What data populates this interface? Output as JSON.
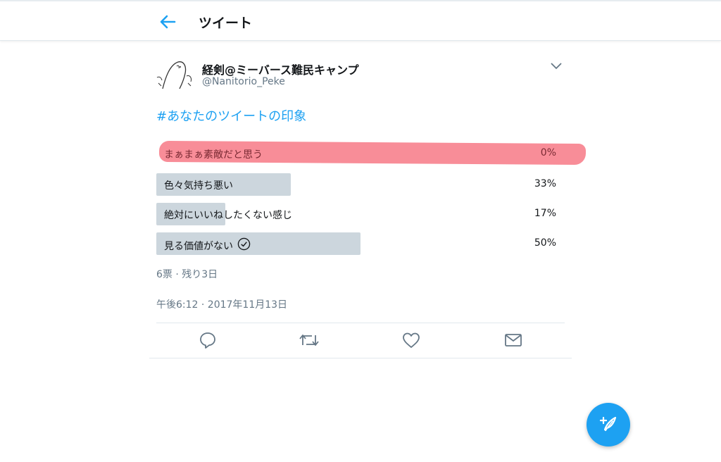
{
  "header": {
    "title": "ツイート"
  },
  "tweet": {
    "author_name": "経剣@ミーバース難民キャンプ",
    "handle": "@Nanitorio_Peke",
    "hashtag": "#あなたのツイートの印象",
    "poll": {
      "options": [
        {
          "label": "まぁまぁ素敵だと思う",
          "percent": "0%",
          "value": 0,
          "highlighted": true
        },
        {
          "label": "色々気持ち悪い",
          "percent": "33%",
          "value": 33
        },
        {
          "label": "絶対にいいねしたくない感じ",
          "percent": "17%",
          "value": 17
        },
        {
          "label": "見る価値がない",
          "percent": "50%",
          "value": 50,
          "voted": true
        }
      ],
      "meta": "6票 · 残り3日"
    },
    "timestamp": "午後6:12 · 2017年11月13日"
  },
  "colors": {
    "accent": "#1da1f2",
    "bar": "#ccd6dd",
    "highlight": "#f7838f",
    "muted": "#657786"
  },
  "icons": [
    "back-arrow-icon",
    "chevron-down-icon",
    "reply-icon",
    "retweet-icon",
    "like-icon",
    "dm-icon",
    "compose-tweet-icon",
    "checkmark-circle-icon"
  ]
}
